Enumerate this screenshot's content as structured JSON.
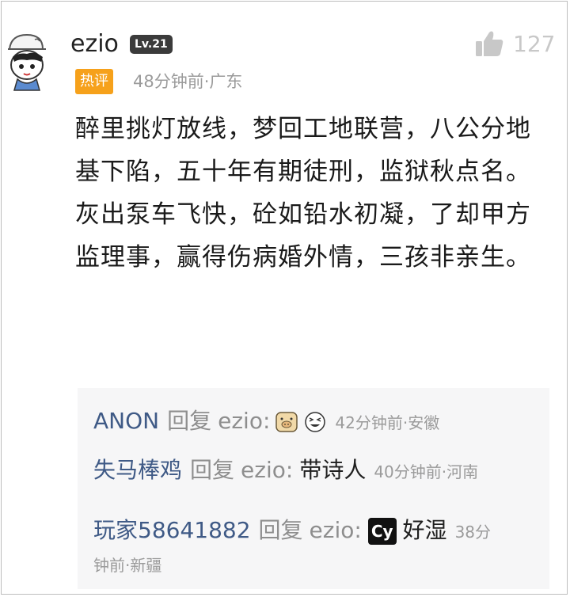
{
  "comment": {
    "username": "ezio",
    "level": "Lv.21",
    "like_count": "127",
    "hot_badge": "热评",
    "meta": "48分钟前·广东",
    "paragraphs": [
      "醉里挑灯放线，梦回工地联营，八公分地基下陷，五十年有期徒刑，监狱秋点名。",
      "灰出泵车飞快，砼如铅水初凝，了却甲方监理事，赢得伤病婚外情，三孩非亲生。"
    ]
  },
  "replies": [
    {
      "name": "ANON",
      "action": "回复",
      "target": "ezio",
      "text": "",
      "time": "42分钟前·安徽",
      "icons": [
        "pig-emoji-icon",
        "laughing-face-emoji-icon"
      ]
    },
    {
      "name": "失马棒鸡",
      "action": "回复",
      "target": "ezio",
      "text": "带诗人",
      "time": "40分钟前·河南"
    },
    {
      "name": "玩家58641882",
      "action": "回复",
      "target": "ezio",
      "text": "好湿",
      "badge": "Cy",
      "time_part1": "38分",
      "time_part2": "钟前·新疆"
    }
  ],
  "colors": {
    "hot_badge": "#f6a11b",
    "reply_name": "#3f5a86",
    "meta": "#9b9b9b",
    "reply_bg": "#f6f6f7"
  }
}
